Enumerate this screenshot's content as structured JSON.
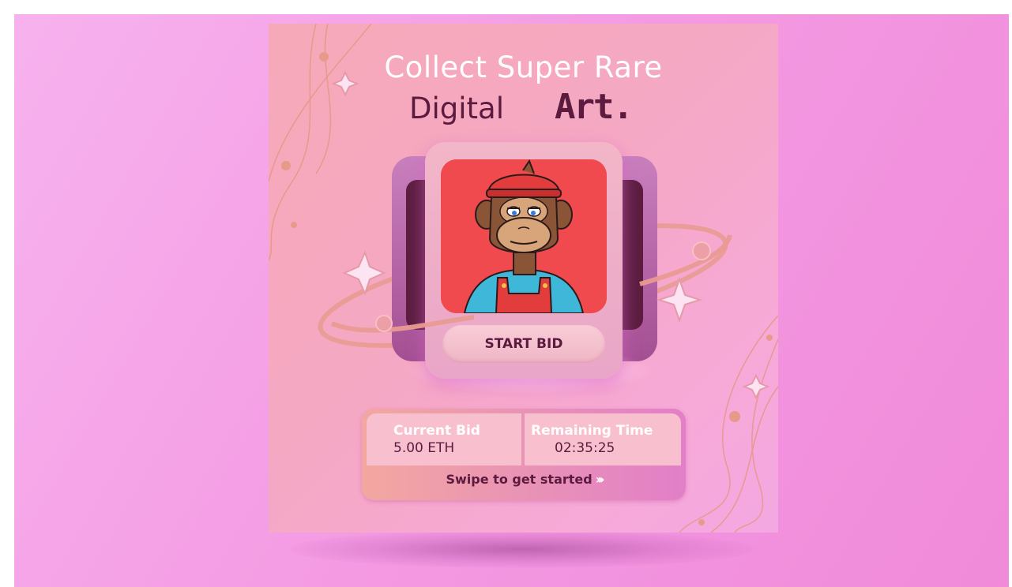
{
  "poster": {
    "title_line1": "Collect Super Rare",
    "title_line2": "Digital",
    "title_art": "Art.",
    "start_bid_label": "START BID",
    "current_bid_label": "Current Bid",
    "current_bid_value": "5.00 ETH",
    "remaining_time_label": "Remaining Time",
    "remaining_time_value": "02:35:25",
    "swipe_label": "Swipe to get started",
    "swipe_icon": "chevrons-right-icon"
  },
  "colors": {
    "background": "#f49ae3",
    "poster": "#f6a9b8",
    "text_dark": "#5b1a3e",
    "nft_background": "#f04a4f"
  }
}
